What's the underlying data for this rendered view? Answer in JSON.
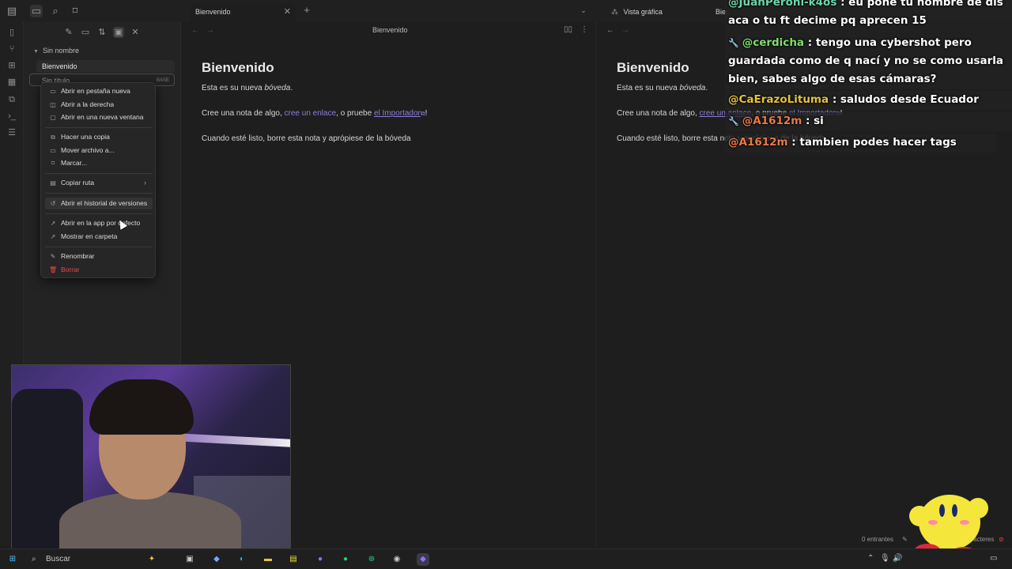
{
  "tabs": {
    "left_tab": "Bienvenido",
    "right_tab": "Vista gráfica",
    "right_tab_partial": "Bienvenido"
  },
  "sidebar": {
    "vault_name": "Sin nombre",
    "files": [
      {
        "label": "Bienvenido"
      },
      {
        "label": "Sin título",
        "ext": "BASE"
      }
    ]
  },
  "context_menu": {
    "items": [
      {
        "label": "Abrir en pestaña nueva",
        "icon": "new-tab-icon"
      },
      {
        "label": "Abrir a la derecha",
        "icon": "split-right-icon"
      },
      {
        "label": "Abrir en una nueva ventana",
        "icon": "new-window-icon"
      },
      {
        "label": "Hacer una copia",
        "icon": "copy-icon"
      },
      {
        "label": "Mover archivo a...",
        "icon": "folder-move-icon"
      },
      {
        "label": "Marcar...",
        "icon": "bookmark-icon"
      },
      {
        "label": "Copiar ruta",
        "icon": "clipboard-icon"
      },
      {
        "label": "Abrir el historial de versiones",
        "icon": "history-icon"
      },
      {
        "label": "Abrir en la app por defecto",
        "icon": "external-link-icon"
      },
      {
        "label": "Mostrar en carpeta",
        "icon": "external-link-icon"
      },
      {
        "label": "Renombrar",
        "icon": "pencil-icon"
      },
      {
        "label": "Borrar",
        "icon": "trash-icon"
      }
    ]
  },
  "note": {
    "pane_title": "Bienvenido",
    "heading": "Bienvenido",
    "line1_prefix": "Esta es su nueva ",
    "line1_em": "bóveda",
    "line1_suffix": ".",
    "line2_prefix": "Cree una nota de algo, ",
    "line2_link1": "cree un enlace",
    "line2_mid": ", o pruebe ",
    "line2_link2": "el Importador",
    "line2_suffix": "!",
    "line3": "Cuando esté listo, borre esta nota y aprópiese de la bóveda"
  },
  "status_bar": {
    "backlinks": "0 entrantes",
    "chars": "caracteres"
  },
  "chat": [
    {
      "user": "@JuanPeroni-k4os",
      "text": " : eu pone tu nombre de dis aca o tu ft decime pq aprecen 15",
      "user_color": "#6fd3a8",
      "mod": false
    },
    {
      "user": "@cerdicha",
      "text": " : tengo una cybershot pero guardada como de q nací y no se como usarla bien, sabes algo de esas cámaras?",
      "user_color": "#7fe06a",
      "mod": true
    },
    {
      "user": "@CaErazoLituma",
      "text": " : saludos desde Ecuador",
      "user_color": "#e8c23a",
      "mod": false
    },
    {
      "user": "@A1612m",
      "text": " : si",
      "user_color": "#e8794a",
      "mod": true
    },
    {
      "user": "@A1612m",
      "text": " : tambien podes hacer tags",
      "user_color": "#e8794a",
      "mod": false
    }
  ],
  "taskbar": {
    "search_placeholder": "Buscar"
  }
}
